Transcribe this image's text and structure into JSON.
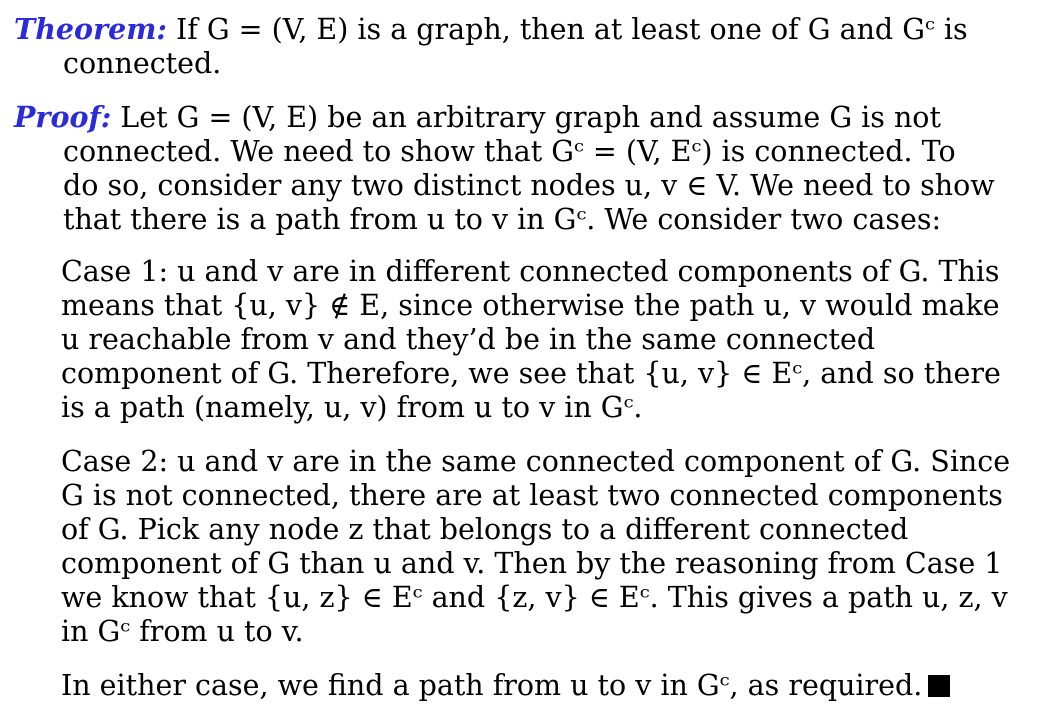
{
  "theorem": {
    "label": "Theorem:",
    "text": " If G = (V, E) is a graph, then at least one of G and Gᶜ is\nconnected."
  },
  "proof": {
    "label": "Proof:",
    "text": " Let G = (V, E) be an arbitrary graph and assume G is not\nconnected. We need to show that Gᶜ = (V, Eᶜ) is connected. To\ndo so, consider any two distinct nodes u, v ∈ V. We need to show\nthat there is a path from u to v in Gᶜ. We consider two cases:"
  },
  "case1": {
    "text": "Case 1: u and v are in different connected components of G. This\nmeans that {u, v} ∉ E, since otherwise the path u, v would make\nu reachable from v and they’d be in the same connected\ncomponent of G. Therefore, we see that {u, v} ∈ Eᶜ, and so there\nis a path (namely, u, v) from u to v in Gᶜ."
  },
  "case2": {
    "text": "Case 2: u and v are in the same connected component of G. Since\nG is not connected, there are at least two connected components\nof G. Pick any node z that belongs to a different connected\ncomponent of G than u and v. Then by the reasoning from Case 1\nwe know that {u, z} ∈ Eᶜ and {z, v} ∈ Eᶜ. This gives a path u, z, v\nin Gᶜ from u to v."
  },
  "conclusion": {
    "text": "In either case, we find a path from u to v in Gᶜ, as required."
  }
}
